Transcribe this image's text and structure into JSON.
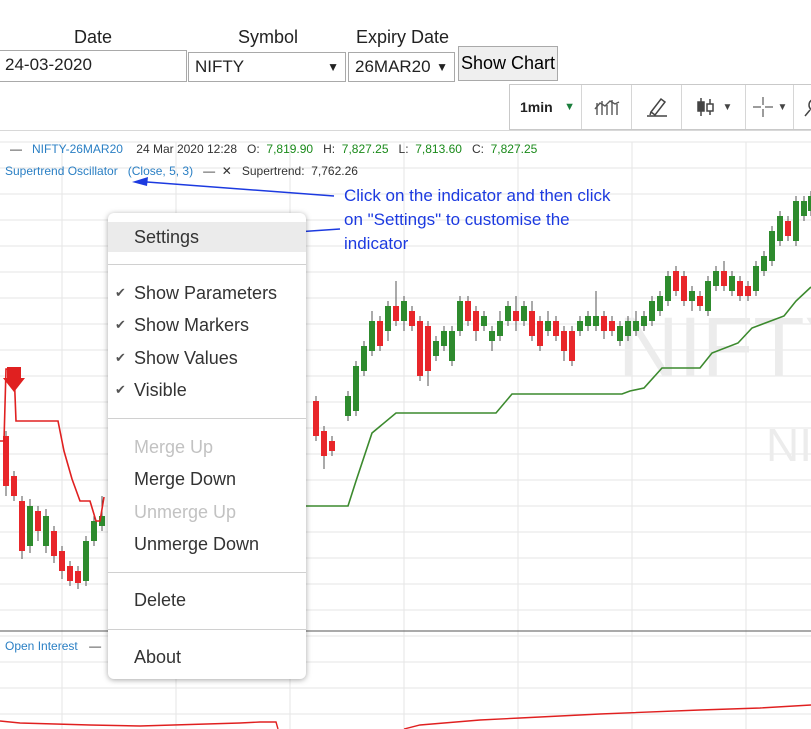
{
  "form": {
    "date_label": "Date",
    "date_value": "24-03-2020",
    "symbol_label": "Symbol",
    "symbol_value": "NIFTY",
    "expiry_label": "Expiry Date",
    "expiry_value": "26MAR20",
    "show_chart_label": "Show Chart"
  },
  "toolbar": {
    "interval": "1min",
    "icons": [
      "bar-chart-icon",
      "drawing-tools-icon",
      "candlestick-icon",
      "crosshair-icon",
      "zoom-icon"
    ]
  },
  "legend": {
    "collapse": "—",
    "symbol": "NIFTY-26MAR20",
    "datetime": "24 Mar 2020 12:28",
    "o_label": "O:",
    "o_value": "7,819.90",
    "h_label": "H:",
    "h_value": "7,827.25",
    "l_label": "L:",
    "l_value": "7,813.60",
    "c_label": "C:",
    "c_value": "7,827.25"
  },
  "indicator": {
    "name": "Supertrend Oscillator",
    "params": "(Close, 5, 3)",
    "minimize": "—",
    "close": "✕",
    "value_label": "Supertrend:",
    "value": "7,762.26"
  },
  "annotation": "Click on the indicator and then click on \"Settings\" to customise the indicator",
  "context_menu": {
    "settings": "Settings",
    "show_parameters": "Show Parameters",
    "show_markers": "Show Markers",
    "show_values": "Show Values",
    "visible": "Visible",
    "merge_up": "Merge Up",
    "merge_down": "Merge Down",
    "unmerge_up": "Unmerge Up",
    "unmerge_down": "Unmerge Down",
    "delete": "Delete",
    "about": "About",
    "check_glyph": "✔"
  },
  "open_interest": {
    "label": "Open Interest",
    "collapse": "—"
  },
  "watermark": "NIFTY",
  "colors": {
    "bull": "#2e8b2e",
    "bear": "#e8262a",
    "supertrend_up": "#3c8a2e",
    "supertrend_down": "#e02020",
    "annotation": "#1c3ae0",
    "legend_link": "#2a7fc4"
  }
}
